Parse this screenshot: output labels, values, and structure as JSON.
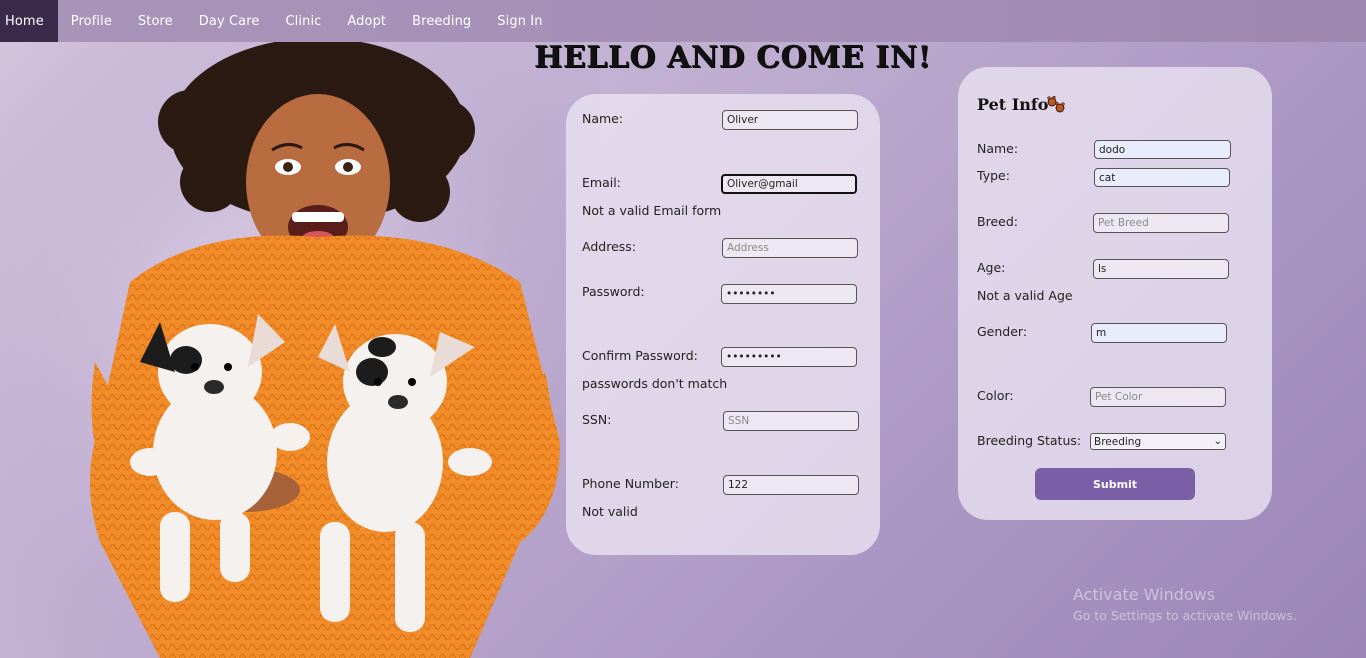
{
  "nav": {
    "items": [
      "Home",
      "Profile",
      "Store",
      "Day Care",
      "Clinic",
      "Adopt",
      "Breeding",
      "Sign In"
    ],
    "active": "Home"
  },
  "heading": "HELLO AND COME IN!",
  "user_form": {
    "name": {
      "label": "Name:",
      "value": "Oliver"
    },
    "email": {
      "label": "Email:",
      "value": "Oliver@gmail",
      "error": "Not a valid Email form"
    },
    "address": {
      "label": "Address:",
      "placeholder": "Address"
    },
    "password": {
      "label": "Password:",
      "value": "••••••••"
    },
    "confirm_password": {
      "label": "Confirm Password:",
      "value": "•••••••••",
      "error": "passwords don't match"
    },
    "ssn": {
      "label": "SSN:",
      "placeholder": "SSN"
    },
    "phone": {
      "label": "Phone Number:",
      "value": "122",
      "error": "Not valid"
    }
  },
  "pet_form": {
    "title": "Pet Info",
    "name": {
      "label": "Name:",
      "value": "dodo"
    },
    "type": {
      "label": "Type:",
      "value": "cat"
    },
    "breed": {
      "label": "Breed:",
      "placeholder": "Pet Breed"
    },
    "age": {
      "label": "Age:",
      "value": "ls",
      "error": "Not a valid Age"
    },
    "gender": {
      "label": "Gender:",
      "value": "m"
    },
    "color": {
      "label": "Color:",
      "placeholder": "Pet Color"
    },
    "breeding_status": {
      "label": "Breeding Status:",
      "selected": "Breeding"
    },
    "submit_label": "Submit"
  },
  "watermark": {
    "line1": "Activate Windows",
    "line2": "Go to Settings to activate Windows."
  },
  "colors": {
    "nav_active": "#3b2a4a",
    "submit": "#7a5fa7",
    "sweater": "#f28c28"
  }
}
